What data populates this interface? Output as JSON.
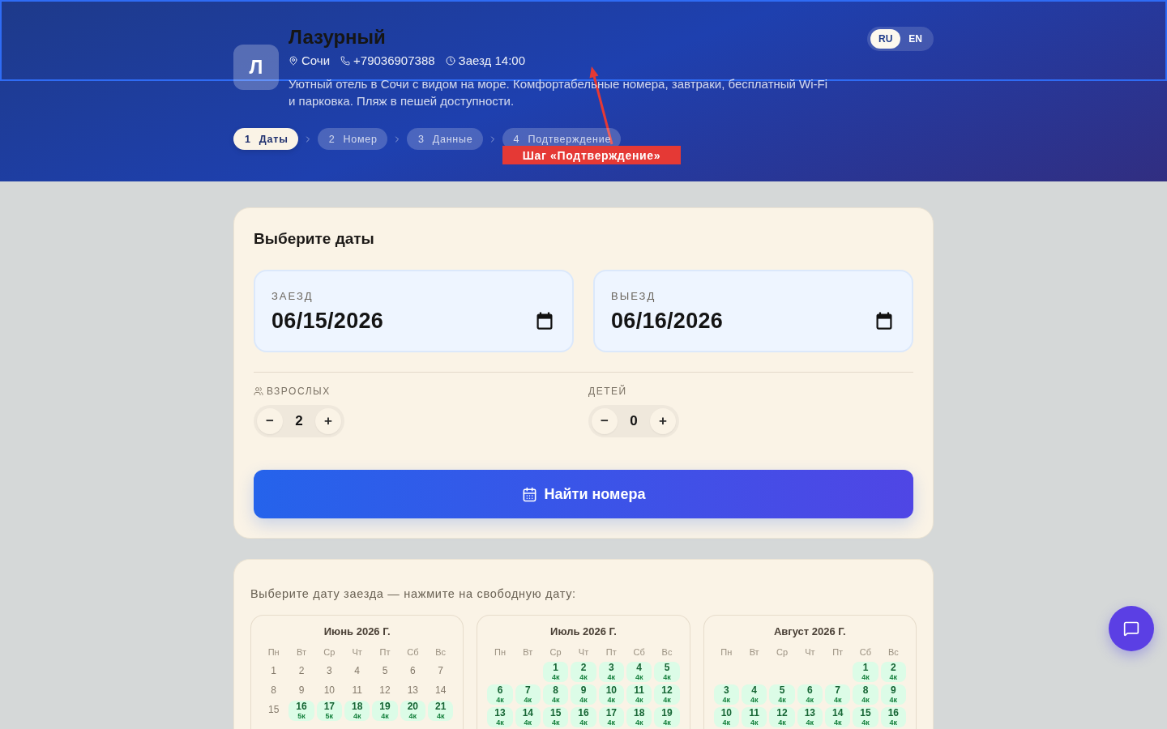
{
  "hotel": {
    "initial": "Л",
    "name": "Лазурный",
    "info": [
      {
        "kind": "location",
        "text": "Сочи"
      },
      {
        "kind": "phone",
        "text": "+79036907388"
      },
      {
        "kind": "time",
        "text": "Заезд 14:00"
      }
    ],
    "description": "Уютный отель в Сочи с видом на море. Комфортабельные номера, завтраки, бесплатный Wi-Fi и парковка. Пляж в пешей доступности."
  },
  "languages": [
    {
      "label": "RU",
      "selected": true
    },
    {
      "label": "EN",
      "selected": false
    }
  ],
  "steps": [
    {
      "number": "1",
      "label": "Даты",
      "selected": true
    },
    {
      "number": "2",
      "label": "Номер",
      "selected": false
    },
    {
      "number": "3",
      "label": "Данные",
      "selected": false
    },
    {
      "number": "4",
      "label": "Подтверждение",
      "selected": false
    }
  ],
  "annotation": {
    "label": "Шаг «Подтверждение»"
  },
  "dates_card": {
    "title": "Выберите даты",
    "fields": [
      {
        "label": "ЗАЕЗД",
        "value": "06/15/2026"
      },
      {
        "label": "ВЫЕЗД",
        "value": "06/16/2026"
      }
    ],
    "guests": [
      {
        "kind": "adults",
        "label": "ВЗРОСЛЫХ",
        "minus": "−",
        "value": "2",
        "plus": "+"
      },
      {
        "kind": "children",
        "label": "ДЕТЕЙ",
        "minus": "−",
        "value": "0",
        "plus": "+"
      }
    ],
    "search_button": "Найти номера"
  },
  "availability": {
    "prompt": "Выберите дату заезда — нажмите на свободную дату:",
    "calendars": [
      {
        "title": "Июнь 2026 Г.",
        "weekdays": [
          "Пн",
          "Вт",
          "Ср",
          "Чт",
          "Пт",
          "Сб",
          "Вс"
        ],
        "weeks": [
          [
            {
              "kind": "day",
              "day": "1",
              "available": false
            },
            {
              "kind": "day",
              "day": "2",
              "available": false
            },
            {
              "kind": "day",
              "day": "3",
              "available": false
            },
            {
              "kind": "day",
              "day": "4",
              "available": false
            },
            {
              "kind": "day",
              "day": "5",
              "available": false
            },
            {
              "kind": "day",
              "day": "6",
              "available": false
            },
            {
              "kind": "day",
              "day": "7",
              "available": false
            }
          ],
          [
            {
              "kind": "day",
              "day": "8",
              "available": false
            },
            {
              "kind": "day",
              "day": "9",
              "available": false
            },
            {
              "kind": "day",
              "day": "10",
              "available": false
            },
            {
              "kind": "day",
              "day": "11",
              "available": false
            },
            {
              "kind": "day",
              "day": "12",
              "available": false
            },
            {
              "kind": "day",
              "day": "13",
              "available": false
            },
            {
              "kind": "day",
              "day": "14",
              "available": false
            }
          ],
          [
            {
              "kind": "day",
              "day": "15",
              "available": false
            },
            {
              "kind": "day",
              "day": "16",
              "available": true,
              "rooms": "5к"
            },
            {
              "kind": "day",
              "day": "17",
              "available": true,
              "rooms": "5к"
            },
            {
              "kind": "day",
              "day": "18",
              "available": true,
              "rooms": "4к"
            },
            {
              "kind": "day",
              "day": "19",
              "available": true,
              "rooms": "4к"
            },
            {
              "kind": "day",
              "day": "20",
              "available": true,
              "rooms": "4к"
            },
            {
              "kind": "day",
              "day": "21",
              "available": true,
              "rooms": "4к"
            }
          ]
        ]
      },
      {
        "title": "Июль 2026 Г.",
        "weekdays": [
          "Пн",
          "Вт",
          "Ср",
          "Чт",
          "Пт",
          "Сб",
          "Вс"
        ],
        "weeks": [
          [
            {
              "kind": "blank"
            },
            {
              "kind": "blank"
            },
            {
              "kind": "day",
              "day": "1",
              "available": true,
              "rooms": "4к"
            },
            {
              "kind": "day",
              "day": "2",
              "available": true,
              "rooms": "4к"
            },
            {
              "kind": "day",
              "day": "3",
              "available": true,
              "rooms": "4к"
            },
            {
              "kind": "day",
              "day": "4",
              "available": true,
              "rooms": "4к"
            },
            {
              "kind": "day",
              "day": "5",
              "available": true,
              "rooms": "4к"
            }
          ],
          [
            {
              "kind": "day",
              "day": "6",
              "available": true,
              "rooms": "4к"
            },
            {
              "kind": "day",
              "day": "7",
              "available": true,
              "rooms": "4к"
            },
            {
              "kind": "day",
              "day": "8",
              "available": true,
              "rooms": "4к"
            },
            {
              "kind": "day",
              "day": "9",
              "available": true,
              "rooms": "4к"
            },
            {
              "kind": "day",
              "day": "10",
              "available": true,
              "rooms": "4к"
            },
            {
              "kind": "day",
              "day": "11",
              "available": true,
              "rooms": "4к"
            },
            {
              "kind": "day",
              "day": "12",
              "available": true,
              "rooms": "4к"
            }
          ],
          [
            {
              "kind": "day",
              "day": "13",
              "available": true,
              "rooms": "4к"
            },
            {
              "kind": "day",
              "day": "14",
              "available": true,
              "rooms": "4к"
            },
            {
              "kind": "day",
              "day": "15",
              "available": true,
              "rooms": "4к"
            },
            {
              "kind": "day",
              "day": "16",
              "available": true,
              "rooms": "4к"
            },
            {
              "kind": "day",
              "day": "17",
              "available": true,
              "rooms": "4к"
            },
            {
              "kind": "day",
              "day": "18",
              "available": true,
              "rooms": "4к"
            },
            {
              "kind": "day",
              "day": "19",
              "available": true,
              "rooms": "4к"
            }
          ]
        ]
      },
      {
        "title": "Август 2026 Г.",
        "weekdays": [
          "Пн",
          "Вт",
          "Ср",
          "Чт",
          "Пт",
          "Сб",
          "Вс"
        ],
        "weeks": [
          [
            {
              "kind": "blank"
            },
            {
              "kind": "blank"
            },
            {
              "kind": "blank"
            },
            {
              "kind": "blank"
            },
            {
              "kind": "blank"
            },
            {
              "kind": "day",
              "day": "1",
              "available": true,
              "rooms": "4к"
            },
            {
              "kind": "day",
              "day": "2",
              "available": true,
              "rooms": "4к"
            }
          ],
          [
            {
              "kind": "day",
              "day": "3",
              "available": true,
              "rooms": "4к"
            },
            {
              "kind": "day",
              "day": "4",
              "available": true,
              "rooms": "4к"
            },
            {
              "kind": "day",
              "day": "5",
              "available": true,
              "rooms": "4к"
            },
            {
              "kind": "day",
              "day": "6",
              "available": true,
              "rooms": "4к"
            },
            {
              "kind": "day",
              "day": "7",
              "available": true,
              "rooms": "4к"
            },
            {
              "kind": "day",
              "day": "8",
              "available": true,
              "rooms": "4к"
            },
            {
              "kind": "day",
              "day": "9",
              "available": true,
              "rooms": "4к"
            }
          ],
          [
            {
              "kind": "day",
              "day": "10",
              "available": true,
              "rooms": "4к"
            },
            {
              "kind": "day",
              "day": "11",
              "available": true,
              "rooms": "4к"
            },
            {
              "kind": "day",
              "day": "12",
              "available": true,
              "rooms": "4к"
            },
            {
              "kind": "day",
              "day": "13",
              "available": true,
              "rooms": "4к"
            },
            {
              "kind": "day",
              "day": "14",
              "available": true,
              "rooms": "4к"
            },
            {
              "kind": "day",
              "day": "15",
              "available": true,
              "rooms": "4к"
            },
            {
              "kind": "day",
              "day": "16",
              "available": true,
              "rooms": "4к"
            }
          ]
        ]
      }
    ]
  }
}
